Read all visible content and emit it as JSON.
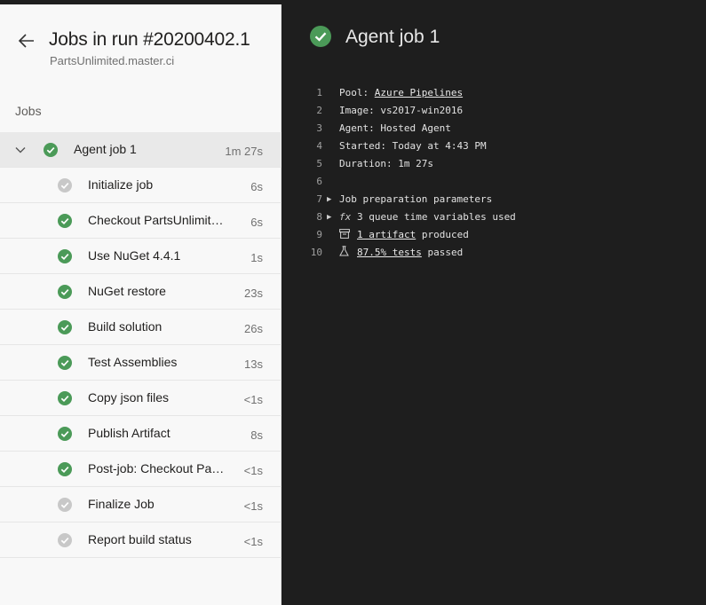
{
  "header": {
    "title": "Jobs in run #20200402.1",
    "subtitle": "PartsUnlimited.master.ci"
  },
  "jobs_label": "Jobs",
  "parent_job": {
    "name": "Agent job 1",
    "duration": "1m 27s",
    "status": "success"
  },
  "steps": [
    {
      "name": "Initialize job",
      "duration": "6s",
      "status": "skipped"
    },
    {
      "name": "Checkout PartsUnlimite…",
      "duration": "6s",
      "status": "success"
    },
    {
      "name": "Use NuGet 4.4.1",
      "duration": "1s",
      "status": "success"
    },
    {
      "name": "NuGet restore",
      "duration": "23s",
      "status": "success"
    },
    {
      "name": "Build solution",
      "duration": "26s",
      "status": "success"
    },
    {
      "name": "Test Assemblies",
      "duration": "13s",
      "status": "success"
    },
    {
      "name": "Copy json files",
      "duration": "<1s",
      "status": "success"
    },
    {
      "name": "Publish Artifact",
      "duration": "8s",
      "status": "success"
    },
    {
      "name": "Post-job: Checkout Pa…",
      "duration": "<1s",
      "status": "success"
    },
    {
      "name": "Finalize Job",
      "duration": "<1s",
      "status": "skipped"
    },
    {
      "name": "Report build status",
      "duration": "<1s",
      "status": "skipped"
    }
  ],
  "detail": {
    "title": "Agent job 1",
    "log": {
      "line1": {
        "num": "1",
        "prefix": "Pool: ",
        "link": "Azure Pipelines"
      },
      "line2": {
        "num": "2",
        "text": "Image: vs2017-win2016"
      },
      "line3": {
        "num": "3",
        "text": "Agent: Hosted Agent"
      },
      "line4": {
        "num": "4",
        "text": "Started: Today at 4:43 PM"
      },
      "line5": {
        "num": "5",
        "text": "Duration: 1m 27s"
      },
      "line6": {
        "num": "6"
      },
      "line7": {
        "num": "7",
        "text": "Job preparation parameters"
      },
      "line8": {
        "num": "8",
        "icon": "fx",
        "text": "3 queue time variables used"
      },
      "line9": {
        "num": "9",
        "link": "1 artifact",
        "suffix": " produced"
      },
      "line10": {
        "num": "10",
        "link": "87.5% tests",
        "suffix": " passed"
      }
    }
  },
  "colors": {
    "success": "#4b9a58",
    "skipped": "#c8c8c8",
    "log_bg": "#1e1e1e",
    "left_bg": "#f8f8f8"
  },
  "icons": {
    "back": "arrow-left-icon",
    "expand": "chevron-down-icon",
    "success": "check-circle-icon",
    "skipped": "circle-check-gray-icon",
    "expander": "triangle-right-icon",
    "variables": "fx-icon",
    "artifact": "artifact-icon",
    "tests": "flask-icon"
  }
}
